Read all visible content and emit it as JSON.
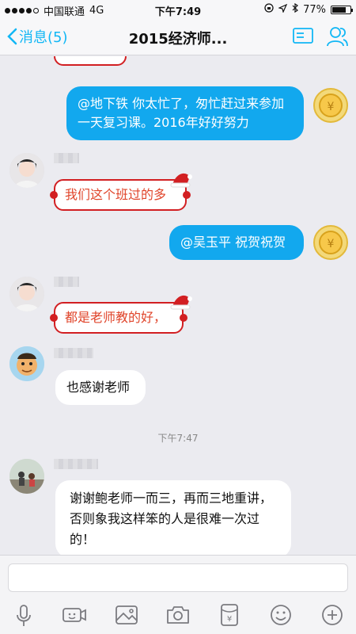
{
  "status": {
    "carrier": "中国联通",
    "network": "4G",
    "time": "下午7:49",
    "battery": "77%",
    "battery_level": 0.77
  },
  "nav": {
    "back_label": "消息(5)",
    "title": "2015经济师..."
  },
  "messages": [
    {
      "text": "@地下铁 你太忙了，匆忙赶过来参加一天复习课。2016年好好努力",
      "direction": "out"
    },
    {
      "text": "我们这个班过的多",
      "direction": "in",
      "style": "festive"
    },
    {
      "text": "@吴玉平 祝贺祝贺",
      "direction": "out"
    },
    {
      "text": "都是老师教的好，",
      "direction": "in",
      "style": "festive"
    },
    {
      "text": "也感谢老师",
      "direction": "in"
    },
    {
      "text": "谢谢鲍老师一而三，再而三地重讲，否则象我这样笨的人是很难一次过的！",
      "direction": "in"
    }
  ],
  "timestamp": "下午7:47",
  "colors": {
    "accent": "#12b7f5",
    "outgoing_bubble": "#12a8ee",
    "festive_red": "#d21f22",
    "festive_text": "#e0452b"
  },
  "icons": [
    "mic-icon",
    "video-icon",
    "image-icon",
    "camera-icon",
    "red-packet-icon",
    "emoji-icon",
    "plus-icon"
  ]
}
